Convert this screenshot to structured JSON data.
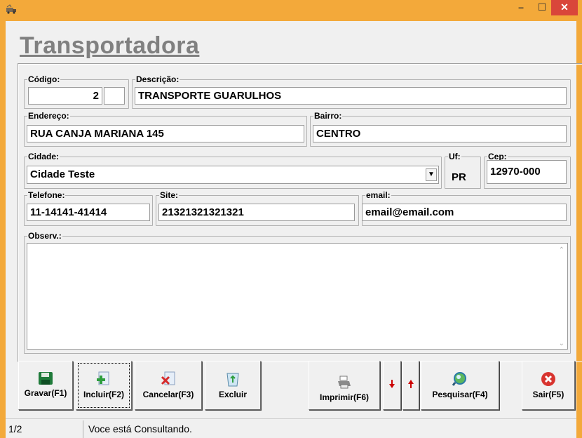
{
  "window": {
    "minimize_label": "–",
    "maximize_label": "☐",
    "close_label": "✕"
  },
  "page_title": "Transportadora",
  "form": {
    "codigo": {
      "label": "Código:",
      "value": "2"
    },
    "descricao": {
      "label": "Descrição:",
      "value": "TRANSPORTE GUARULHOS"
    },
    "endereco": {
      "label": "Endereço:",
      "value": "RUA CANJA MARIANA 145"
    },
    "bairro": {
      "label": "Bairro:",
      "value": "CENTRO"
    },
    "cidade": {
      "label": "Cidade:",
      "value": "Cidade Teste"
    },
    "uf": {
      "label": "Uf:",
      "value": "PR"
    },
    "cep": {
      "label": "Cep:",
      "value": "12970-000"
    },
    "telefone": {
      "label": "Telefone:",
      "value": "11-14141-41414"
    },
    "site": {
      "label": "Site:",
      "value": "21321321321321"
    },
    "email": {
      "label": "email:",
      "value": "email@email.com"
    },
    "observ": {
      "label": "Observ.:",
      "value": ""
    }
  },
  "toolbar": {
    "gravar": "Gravar(F1)",
    "incluir": "Incluir(F2)",
    "cancelar": "Cancelar(F3)",
    "excluir": "Excluir",
    "imprimir": "Imprimir(F6)",
    "pesquisar": "Pesquisar(F4)",
    "sair": "Sair(F5)"
  },
  "status": {
    "record": "1/2",
    "message": "Voce está Consultando."
  },
  "colors": {
    "titlebar": "#f3a93a",
    "close_button": "#d9463a",
    "title_text": "#808080"
  }
}
